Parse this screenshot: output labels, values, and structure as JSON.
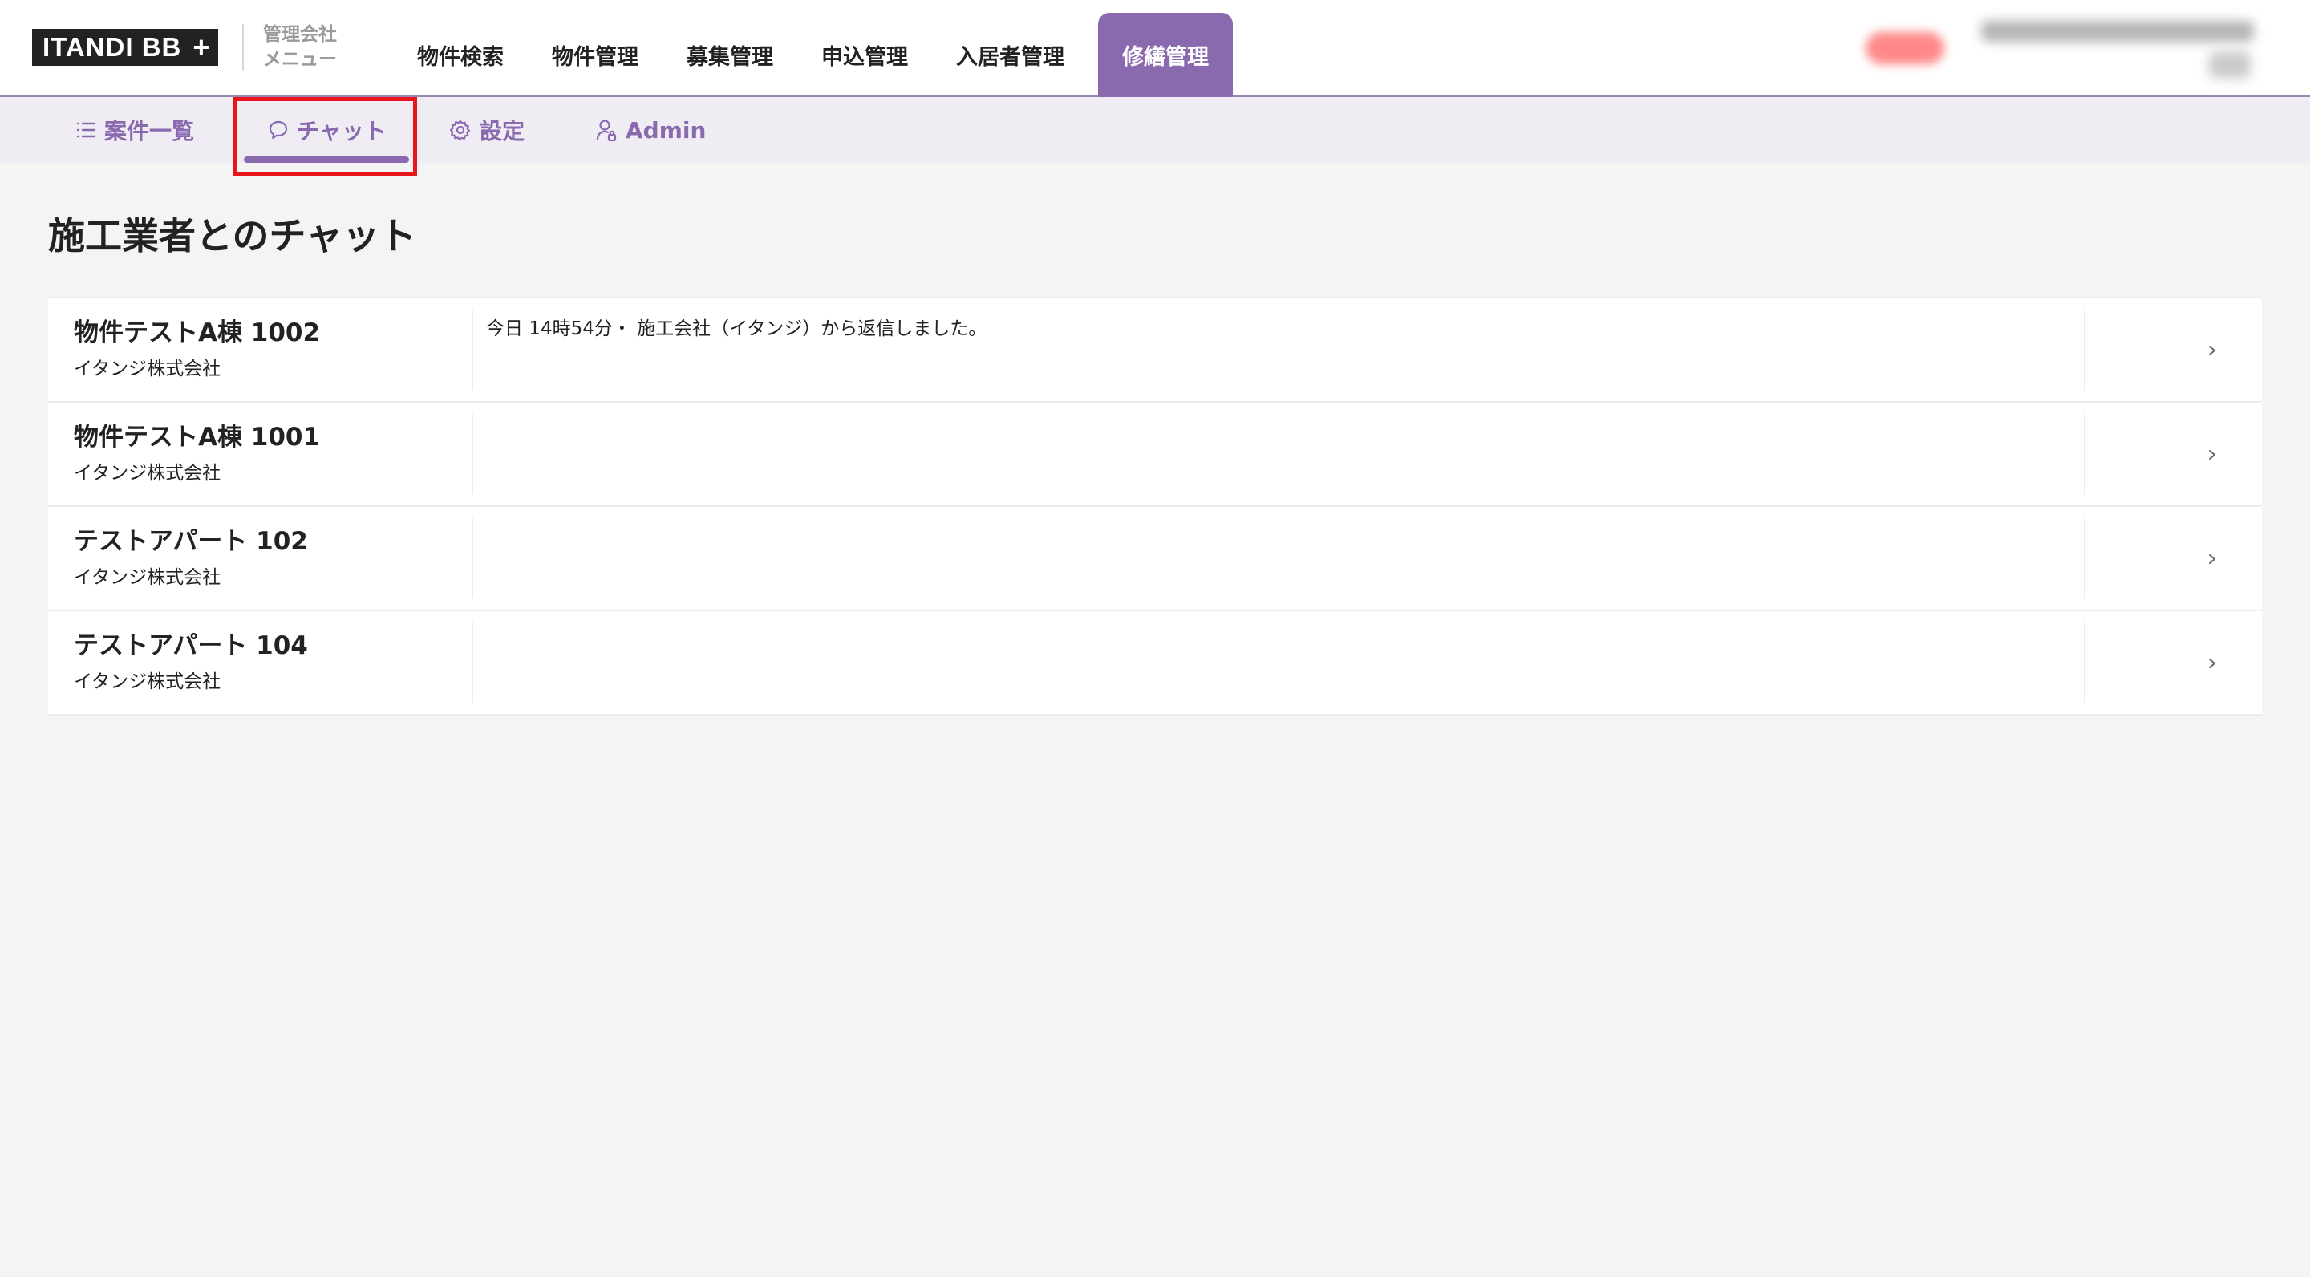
{
  "header": {
    "logo": {
      "text": "ITANDI BB",
      "plus": "+"
    },
    "company_menu": {
      "line1": "管理会社",
      "line2": "メニュー"
    },
    "nav": [
      {
        "label": "物件検索"
      },
      {
        "label": "物件管理"
      },
      {
        "label": "募集管理"
      },
      {
        "label": "申込管理"
      },
      {
        "label": "入居者管理"
      },
      {
        "label": "修繕管理",
        "active": true
      }
    ]
  },
  "subnav": {
    "items": [
      {
        "label": "案件一覧",
        "icon": "list-icon"
      },
      {
        "label": "チャット",
        "icon": "chat-bubble-icon",
        "active": true
      },
      {
        "label": "設定",
        "icon": "gear-icon"
      },
      {
        "label": "Admin",
        "icon": "user-lock-icon"
      }
    ]
  },
  "main": {
    "title": "施工業者とのチャット",
    "chats": [
      {
        "name": "物件テストA棟 1002",
        "company": "イタンジ株式会社",
        "message": "今日 14時54分・ 施工会社（イタンジ）から返信しました。"
      },
      {
        "name": "物件テストA棟 1001",
        "company": "イタンジ株式会社",
        "message": ""
      },
      {
        "name": "テストアパート 102",
        "company": "イタンジ株式会社",
        "message": ""
      },
      {
        "name": "テストアパート 104",
        "company": "イタンジ株式会社",
        "message": ""
      }
    ]
  },
  "colors": {
    "accent": "#8a6aae",
    "subnav_bg": "#f0ecf4",
    "page_bg": "#f4f4f4",
    "highlight": "#e8161b"
  }
}
